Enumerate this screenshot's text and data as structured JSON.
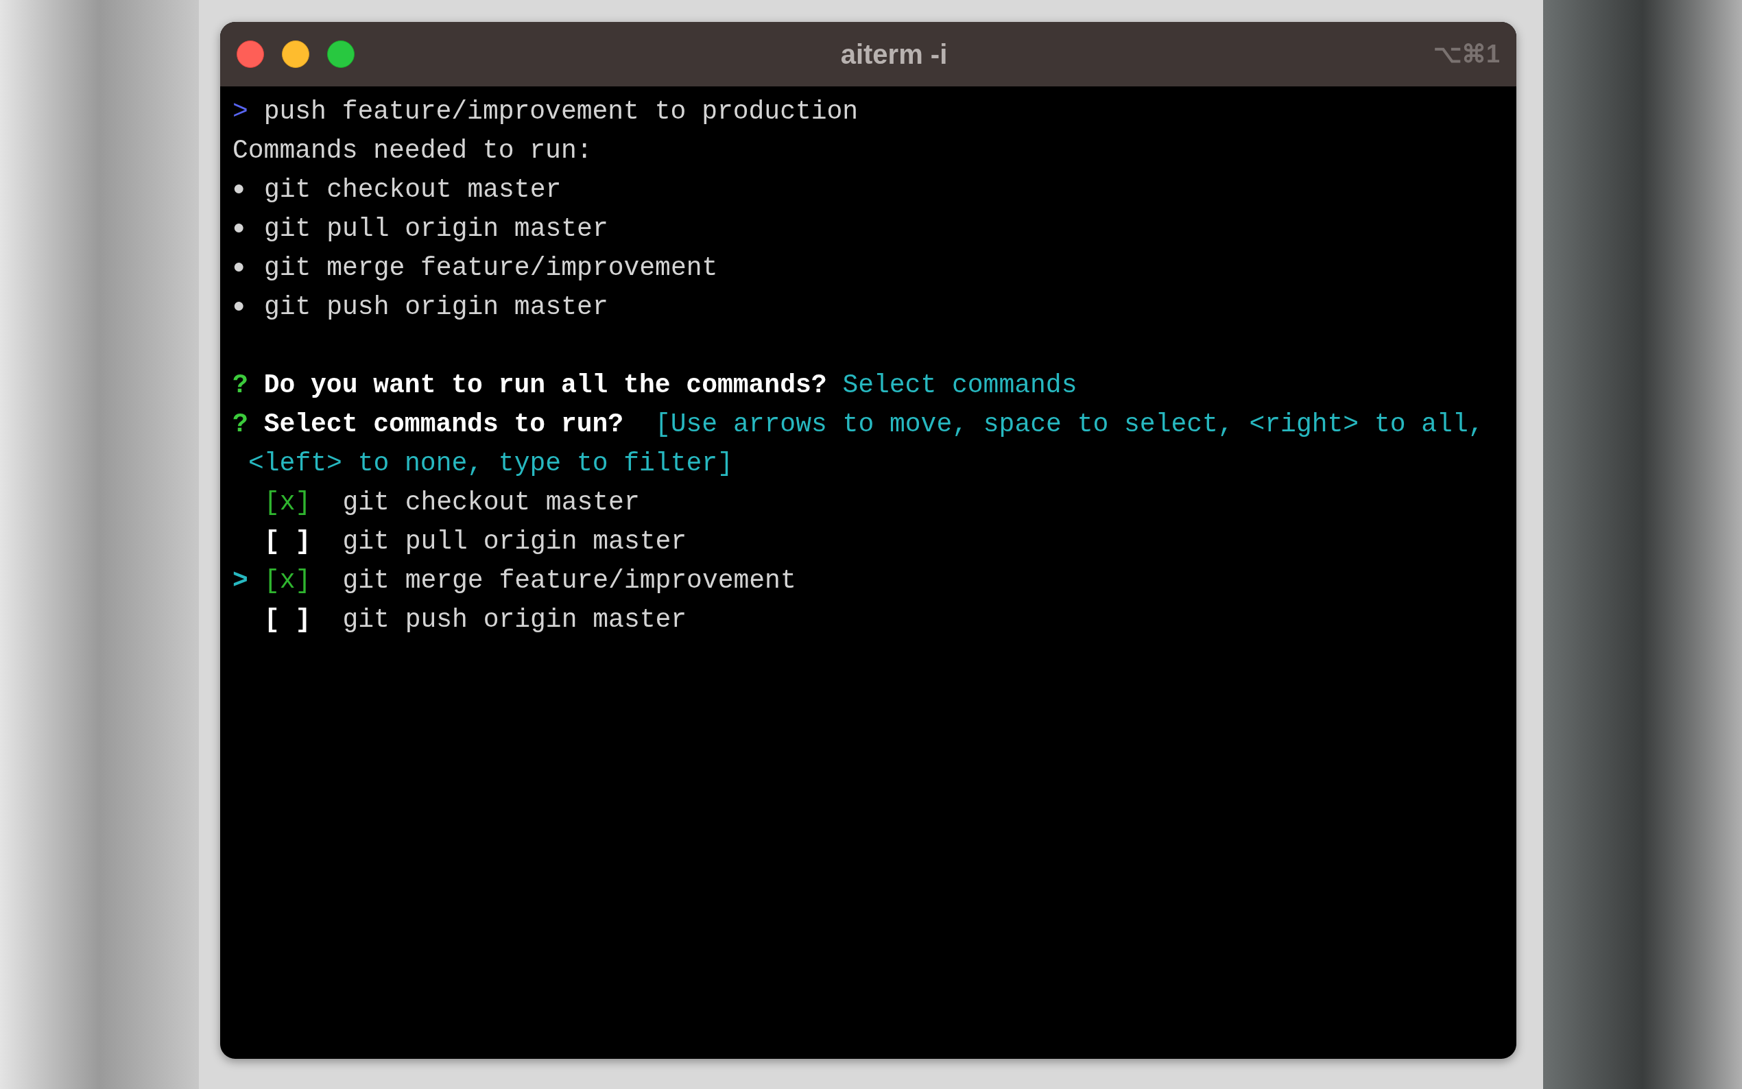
{
  "window": {
    "title": "aiterm -i",
    "shortcut": "⌥⌘1"
  },
  "terminal": {
    "prompt": ">",
    "command": "push feature/improvement to production",
    "heading": "Commands needed to run:",
    "bullet": "●",
    "commands": [
      "git checkout master",
      "git pull origin master",
      "git merge feature/improvement",
      "git push origin master"
    ],
    "questions": [
      {
        "mark": "?",
        "text": "Do you want to run all the commands?",
        "answer": "Select commands"
      },
      {
        "mark": "?",
        "text": "Select commands to run?",
        "hint_lines": [
          "[Use arrows to move, space to select, <right> to all,",
          "<left> to none, type to filter]"
        ]
      }
    ],
    "cursor": ">",
    "choices": [
      {
        "box": "[x]",
        "label": "git checkout master",
        "checked": true,
        "selected": false
      },
      {
        "box": "[ ]",
        "label": "git pull origin master",
        "checked": false,
        "selected": false
      },
      {
        "box": "[x]",
        "label": "git merge feature/improvement",
        "checked": true,
        "selected": true
      },
      {
        "box": "[ ]",
        "label": "git push origin master",
        "checked": false,
        "selected": false
      }
    ]
  }
}
